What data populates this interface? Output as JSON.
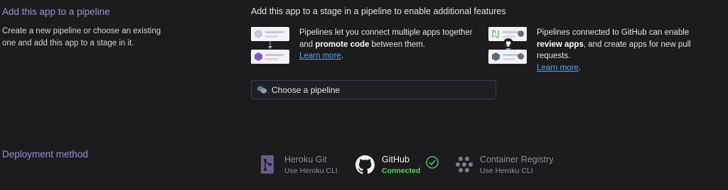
{
  "pipeline_section": {
    "title": "Add this app to a pipeline",
    "description": "Create a new pipeline or choose an existing one and add this app to a stage in it.",
    "right_title": "Add this app to a stage in a pipeline to enable additional features",
    "feature_promote": {
      "text_before": "Pipelines let you connect multiple apps together and ",
      "bold": "promote code",
      "text_after": " between them.",
      "link": "Learn more",
      "end": "."
    },
    "feature_github": {
      "text_before": "Pipelines connected to GitHub can enable ",
      "bold": "review apps",
      "text_after": ", and create apps for new pull requests.",
      "link": "Learn more",
      "end": "."
    },
    "select_placeholder": "Choose a pipeline"
  },
  "deployment_section": {
    "title": "Deployment method",
    "methods": [
      {
        "name": "Heroku Git",
        "sub": "Use Heroku CLI",
        "icon": "heroku-git-icon"
      },
      {
        "name": "GitHub",
        "sub": "Connected",
        "icon": "github-icon"
      },
      {
        "name": "Container Registry",
        "sub": "Use Heroku CLI",
        "icon": "container-registry-icon"
      }
    ]
  },
  "colors": {
    "accent_purple": "#9e8bd0",
    "link_blue": "#4aa3ff",
    "connected_green": "#59d65a"
  }
}
